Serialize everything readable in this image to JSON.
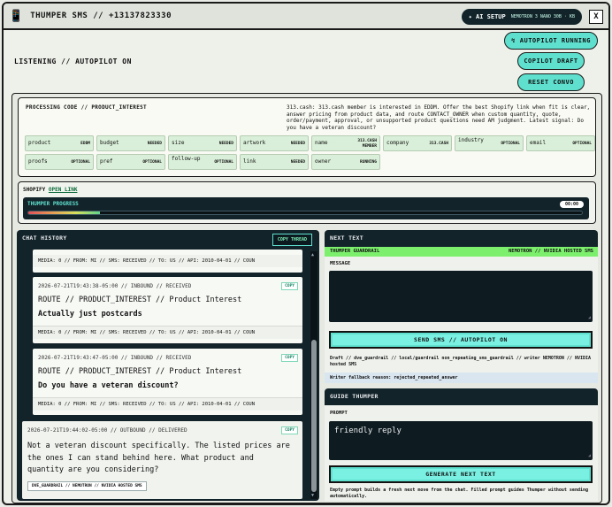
{
  "app": {
    "title": "THUMPER SMS // +13137823330",
    "phone_icon": "phone-icon",
    "ai_setup": "✦ AI SETUP",
    "ai_setup_sub": "NEMOTRON 3 NANO 30B · KB",
    "close_label": "X"
  },
  "status": {
    "listening": "LISTENING // AUTOPILOT ON"
  },
  "controls": {
    "autopilot_icon": "↯",
    "autopilot_label": "AUTOPILOT RUNNING",
    "copilot_label": "COPILOT DRAFT",
    "reset_label": "RESET CONVO"
  },
  "processing": {
    "title": "PROCESSING CODE // PRODUCT_INTEREST",
    "description": "313.cash: 313.cash member is interested in EDDM. Offer the best Shopify link when fit is clear, answer pricing from product data, and route CONTACT_OWNER when custom quantity, quote, order/payment, approval, or unsupported product questions need AM judgment. Latest signal: Do you have a veteran discount?",
    "fields": [
      {
        "key": "product",
        "value": "EDDM"
      },
      {
        "key": "budget",
        "value": "NEEDED"
      },
      {
        "key": "size",
        "value": "NEEDED"
      },
      {
        "key": "artwork",
        "value": "NEEDED"
      },
      {
        "key": "name",
        "value": "313.CASH MEMBER"
      },
      {
        "key": "company",
        "value": "313.CASH"
      },
      {
        "key": "industry",
        "value": "OPTIONAL"
      },
      {
        "key": "email",
        "value": "OPTIONAL"
      },
      {
        "key": "proofs",
        "value": "OPTIONAL"
      },
      {
        "key": "pref",
        "value": "OPTIONAL"
      },
      {
        "key": "follow-up",
        "value": "OPTIONAL"
      },
      {
        "key": "link",
        "value": "NEEDED"
      },
      {
        "key": "owner",
        "value": "RUNNING"
      }
    ]
  },
  "shopify": {
    "label": "SHOPIFY",
    "link": "OPEN LINK",
    "progress_label": "THUMPER PROGRESS",
    "timer": "00:00",
    "progress": 0.13
  },
  "chat": {
    "title": "CHAT HISTORY",
    "copy_thread": "COPY THREAD",
    "first_media": "MEDIA: 0 // FROM: MI // SMS: RECEIVED // TO: US // API: 2010-04-01 // COUN",
    "messages": [
      {
        "meta": "2026-07-21T19:43:38-05:00 // INBOUND // RECEIVED",
        "copy": "COPY",
        "route": "ROUTE // PRODUCT_INTEREST // Product Interest",
        "body": "Actually just postcards",
        "media": "MEDIA: 0 // FROM: MI // SMS: RECEIVED // TO: US // API: 2010-04-01 // COUN"
      },
      {
        "meta": "2026-07-21T19:43:47-05:00 // INBOUND // RECEIVED",
        "copy": "COPY",
        "route": "ROUTE // PRODUCT_INTEREST // Product Interest",
        "body": "Do you have a veteran discount?",
        "media": "MEDIA: 0 // FROM: MI // SMS: RECEIVED // TO: US // API: 2010-04-01 // COUN"
      }
    ],
    "outbound": {
      "meta": "2026-07-21T19:44:02-05:00 // OUTBOUND // DELIVERED",
      "copy": "COPY",
      "body": "Not a veteran discount specifically. The listed prices are the ones I can stand behind here. What product and quantity are you considering?",
      "tag": "DVE_GUARDRAIL // NEMOTRON // NVIDIA HOSTED SMS"
    }
  },
  "next_text": {
    "title": "NEXT TEXT",
    "guardrail_left": "THUMPER GUARDRAIL",
    "guardrail_right": "NEMOTRON // NVIDIA HOSTED SMS",
    "message_label": "MESSAGE",
    "message_value": "",
    "send_label": "SEND SMS // AUTOPILOT ON",
    "draft_note": "Draft // dve_guardrail // local/guardrail non_repeating_sms_guardrail // writer NEMOTRON // NVIDIA hosted SMS",
    "fallback": "Writer fallback reason: rejected_repeated_answer"
  },
  "guide": {
    "title": "GUIDE THUMPER",
    "prompt_label": "PROMPT",
    "prompt_value": "friendly reply",
    "generate_label": "GENERATE NEXT TEXT",
    "note": "Empty prompt builds a fresh next move from the chat. Filled prompt guides Thumper without sending automatically."
  }
}
